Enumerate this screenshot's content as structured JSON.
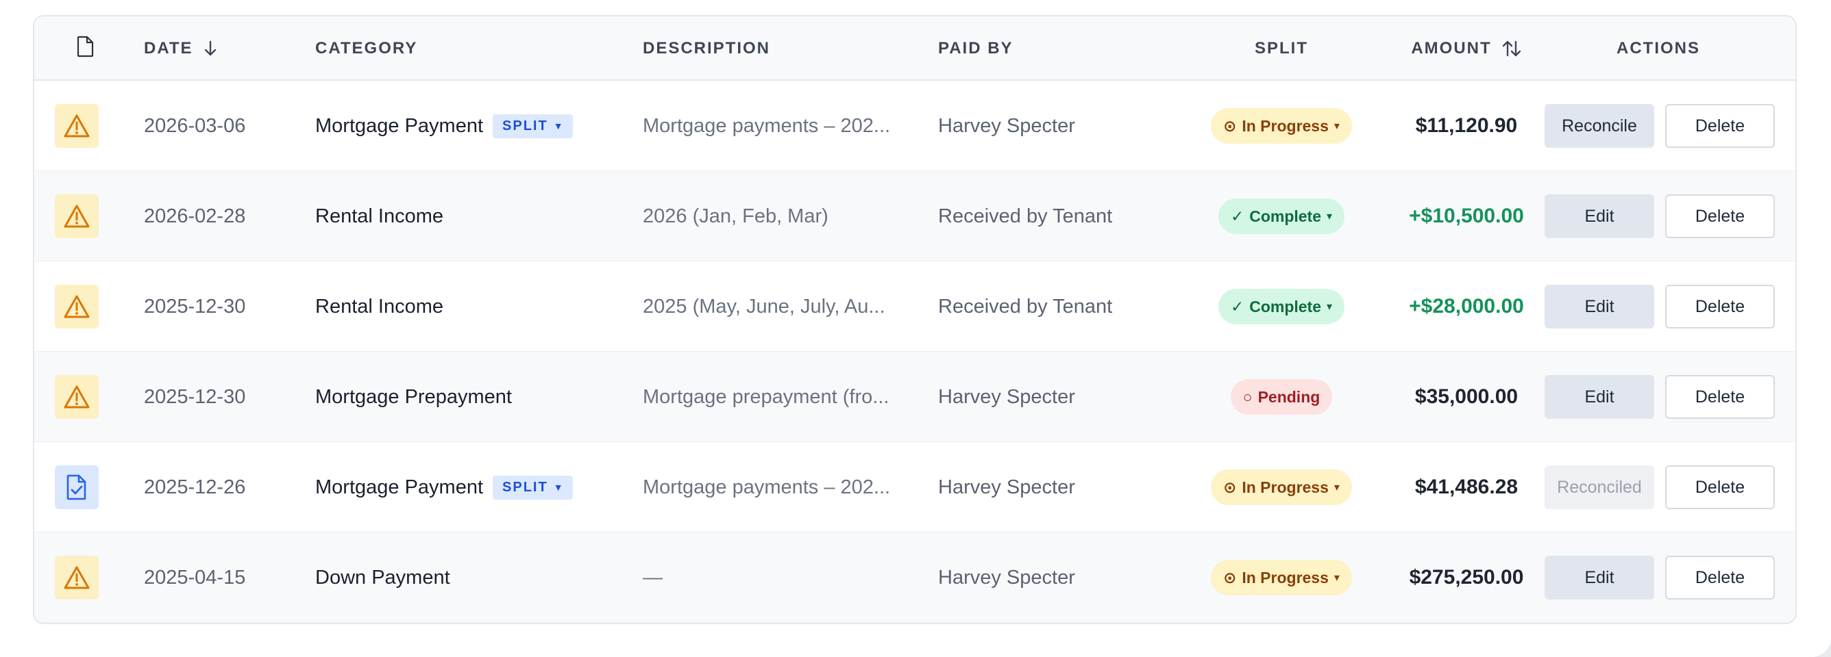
{
  "headers": {
    "date": "DATE",
    "category": "CATEGORY",
    "description": "DESCRIPTION",
    "paid_by": "PAID BY",
    "split": "SPLIT",
    "amount": "AMOUNT",
    "actions": "ACTIONS"
  },
  "colors": {
    "warning": "#d97706",
    "doc": "#2563eb",
    "positive": "#15925a"
  },
  "rows": [
    {
      "icon": "warning-icon",
      "date": "2026-03-06",
      "category": "Mortgage Payment",
      "split_tag": "SPLIT",
      "description": "Mortgage payments – 202...",
      "paid_by": "Harvey Specter",
      "status": "In Progress",
      "status_glyph": "⊙",
      "status_caret": "▾",
      "amount": "$11,120.90",
      "action": "Reconcile",
      "delete": "Delete"
    },
    {
      "icon": "warning-icon",
      "date": "2026-02-28",
      "category": "Rental Income",
      "split_tag": "",
      "description": "2026 (Jan, Feb, Mar)",
      "paid_by": "Received by Tenant",
      "status": "Complete",
      "status_glyph": "✓",
      "status_caret": "▾",
      "amount": "+$10,500.00",
      "action": "Edit",
      "delete": "Delete"
    },
    {
      "icon": "warning-icon",
      "date": "2025-12-30",
      "category": "Rental Income",
      "split_tag": "",
      "description": "2025 (May, June, July, Au...",
      "paid_by": "Received by Tenant",
      "status": "Complete",
      "status_glyph": "✓",
      "status_caret": "▾",
      "amount": "+$28,000.00",
      "action": "Edit",
      "delete": "Delete"
    },
    {
      "icon": "warning-icon",
      "date": "2025-12-30",
      "category": "Mortgage Prepayment",
      "split_tag": "",
      "description": "Mortgage prepayment (fro...",
      "paid_by": "Harvey Specter",
      "status": "Pending",
      "status_glyph": "○",
      "status_caret": "",
      "amount": "$35,000.00",
      "action": "Edit",
      "delete": "Delete"
    },
    {
      "icon": "doc-check-icon",
      "date": "2025-12-26",
      "category": "Mortgage Payment",
      "split_tag": "SPLIT",
      "description": "Mortgage payments – 202...",
      "paid_by": "Harvey Specter",
      "status": "In Progress",
      "status_glyph": "⊙",
      "status_caret": "▾",
      "amount": "$41,486.28",
      "action": "Reconciled",
      "delete": "Delete"
    },
    {
      "icon": "warning-icon",
      "date": "2025-04-15",
      "category": "Down Payment",
      "split_tag": "",
      "description": "—",
      "paid_by": "Harvey Specter",
      "status": "In Progress",
      "status_glyph": "⊙",
      "status_caret": "▾",
      "amount": "$275,250.00",
      "action": "Edit",
      "delete": "Delete"
    }
  ]
}
